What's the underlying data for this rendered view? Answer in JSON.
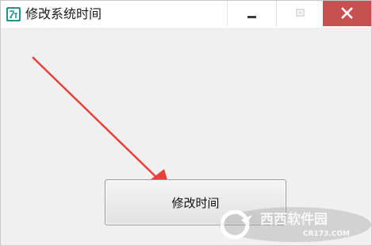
{
  "window": {
    "title": "修改系统时间",
    "app_icon": "calendar-icon"
  },
  "controls": {
    "minimize_icon": "minimize-icon",
    "maximize_icon": "maximize-icon",
    "close_icon": "close-icon",
    "close_color": "#c75050"
  },
  "main": {
    "button_label": "修改时间"
  },
  "annotation": {
    "arrow_color": "#e8403a"
  },
  "watermark": {
    "brand": "西西软件园",
    "url": "CR173.COM"
  }
}
